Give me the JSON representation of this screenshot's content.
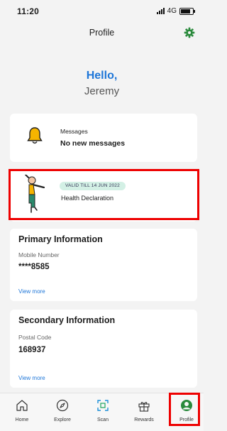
{
  "status_bar": {
    "time": "11:20",
    "network": "4G"
  },
  "header": {
    "title": "Profile",
    "settings_icon": "gear-icon"
  },
  "greeting": {
    "hello": "Hello,",
    "name": "Jeremy"
  },
  "messages": {
    "label": "Messages",
    "value": "No new messages",
    "icon": "bell-icon"
  },
  "health": {
    "badge": "VALID TILL 14 JUN 2022",
    "title": "Health Declaration"
  },
  "primary": {
    "title": "Primary Information",
    "field_label": "Mobile Number",
    "field_value": "****8585",
    "link": "View more"
  },
  "secondary": {
    "title": "Secondary Information",
    "field_label": "Postal Code",
    "field_value": "168937",
    "link": "View more"
  },
  "tabs": [
    {
      "label": "Home",
      "icon": "home-icon"
    },
    {
      "label": "Explore",
      "icon": "compass-icon"
    },
    {
      "label": "Scan",
      "icon": "scan-icon"
    },
    {
      "label": "Rewards",
      "icon": "gift-icon"
    },
    {
      "label": "Profile",
      "icon": "profile-icon"
    }
  ],
  "colors": {
    "accent": "#1e76d8",
    "gear": "#2a8a3c",
    "highlight": "#ee0000",
    "badge_bg": "#d3f0e5",
    "bell": "#f5b400"
  }
}
